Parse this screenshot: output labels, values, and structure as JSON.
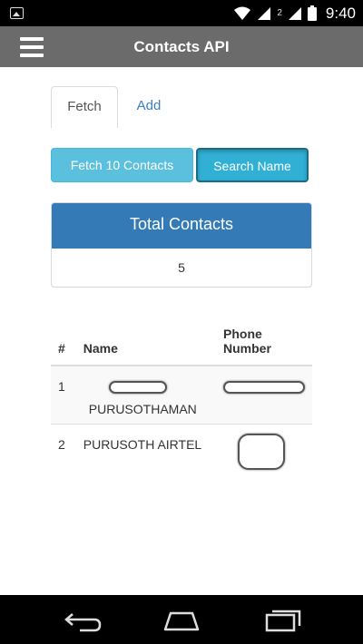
{
  "status_bar": {
    "time": "9:40",
    "sim_label": "2",
    "icons": [
      "image-notification-icon",
      "wifi-icon",
      "signal-icon",
      "battery-icon"
    ]
  },
  "app_bar": {
    "title": "Contacts API",
    "menu_icon": "hamburger-menu-icon",
    "background": "#6b6b6b"
  },
  "tabs": [
    {
      "label": "Fetch",
      "active": true
    },
    {
      "label": "Add",
      "active": false
    }
  ],
  "buttons": {
    "fetch_label": "Fetch 10 Contacts",
    "search_label": "Search Name"
  },
  "summary": {
    "title": "Total Contacts",
    "value": "5"
  },
  "table": {
    "headers": [
      "#",
      "Name",
      "Phone Number"
    ],
    "rows": [
      {
        "num": "1",
        "name": "PURUSOTHAMAN",
        "phone": ""
      },
      {
        "num": "2",
        "name": "PURUSOTH AIRTEL",
        "phone": ""
      }
    ]
  },
  "nav_bar": {
    "icons": [
      "back-icon",
      "home-icon",
      "recent-apps-icon"
    ]
  },
  "colors": {
    "info_button": "#5bc0de",
    "panel_header": "#337ab7",
    "tab_link": "#3a7fc1"
  }
}
